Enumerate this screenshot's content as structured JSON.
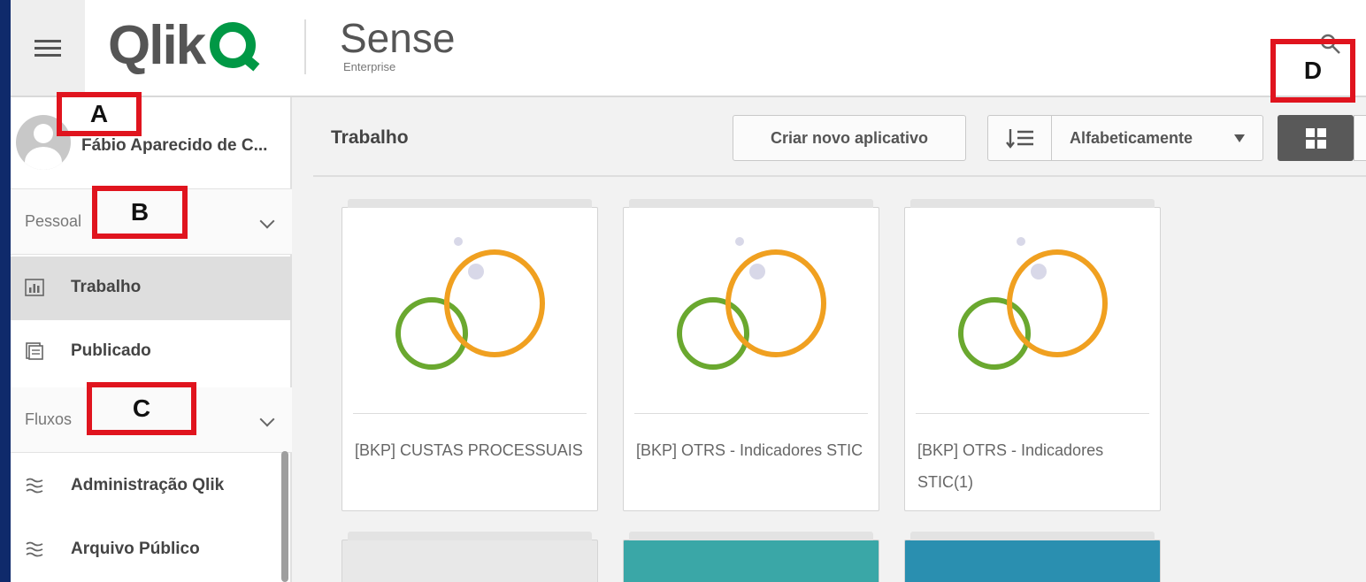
{
  "header": {
    "brand": "Qlik",
    "product": "Sense",
    "product_sub": "Enterprise",
    "search_icon": "search-icon",
    "menu_icon": "hamburger-menu-icon"
  },
  "annotations": {
    "a": "A",
    "b": "B",
    "c": "C",
    "d": "D",
    "color": "#e0141e"
  },
  "sidebar": {
    "user_name": "Fábio Aparecido de C...",
    "sections": [
      {
        "label": "Pessoal"
      },
      {
        "label": "Fluxos"
      }
    ],
    "personal_items": [
      {
        "label": "Trabalho",
        "icon": "work-chart-icon",
        "active": true
      },
      {
        "label": "Publicado",
        "icon": "published-icon",
        "active": false
      }
    ],
    "stream_items": [
      {
        "label": "Administração Qlik",
        "icon": "stream-icon"
      },
      {
        "label": "Arquivo Público",
        "icon": "stream-icon"
      }
    ]
  },
  "main": {
    "title": "Trabalho",
    "create_button": "Criar novo aplicativo",
    "sort_label": "Alfabeticamente",
    "view_mode": "grid",
    "apps": [
      {
        "title": "[BKP] CUSTAS PROCESSUAIS"
      },
      {
        "title": "[BKP] OTRS - Indicadores STIC"
      },
      {
        "title": "[BKP] OTRS - Indicadores STIC(1)"
      }
    ],
    "partial_card_colors": [
      "#e8e8e8",
      "#3aa7a7",
      "#2a8fb0"
    ]
  },
  "colors": {
    "qlik_green": "#009845",
    "ring_green": "#6aa82f",
    "ring_orange": "#f0a020",
    "active_nav": "#dedede",
    "grid_button": "#595959"
  }
}
